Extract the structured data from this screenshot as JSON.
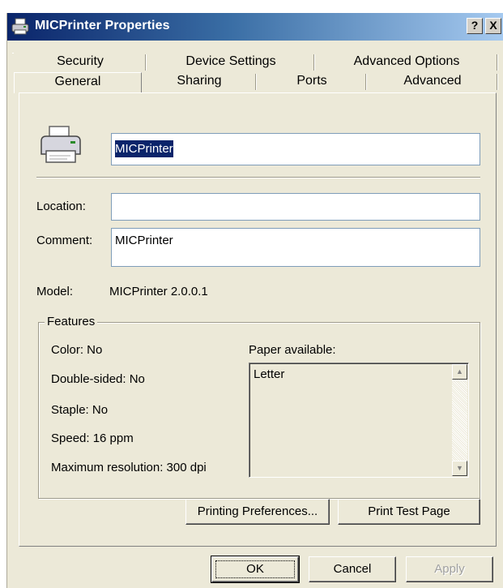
{
  "window": {
    "title": "MICPrinter Properties",
    "help_label": "?",
    "close_label": "X"
  },
  "tabs": {
    "row1": [
      "Security",
      "Device Settings",
      "Advanced Options"
    ],
    "row2": [
      "General",
      "Sharing",
      "Ports",
      "Advanced"
    ],
    "active": "General"
  },
  "general": {
    "printer_name": "MICPrinter",
    "location_label": "Location:",
    "location_value": "",
    "comment_label": "Comment:",
    "comment_value": "MICPrinter",
    "model_label": "Model:",
    "model_value": "MICPrinter 2.0.0.1"
  },
  "features": {
    "legend": "Features",
    "color": "Color: No",
    "double_sided": "Double-sided: No",
    "staple": "Staple: No",
    "speed": "Speed: 16 ppm",
    "max_resolution": "Maximum resolution: 300 dpi",
    "paper_label": "Paper available:",
    "paper_items": [
      "Letter"
    ]
  },
  "buttons": {
    "printing_preferences": "Printing Preferences...",
    "print_test_page": "Print Test Page",
    "ok": "OK",
    "cancel": "Cancel",
    "apply": "Apply"
  },
  "colors": {
    "title_bar_start": "#0a246a",
    "title_bar_end": "#a6caf0",
    "dialog_face": "#ece9d8",
    "selection": "#0a246a"
  }
}
